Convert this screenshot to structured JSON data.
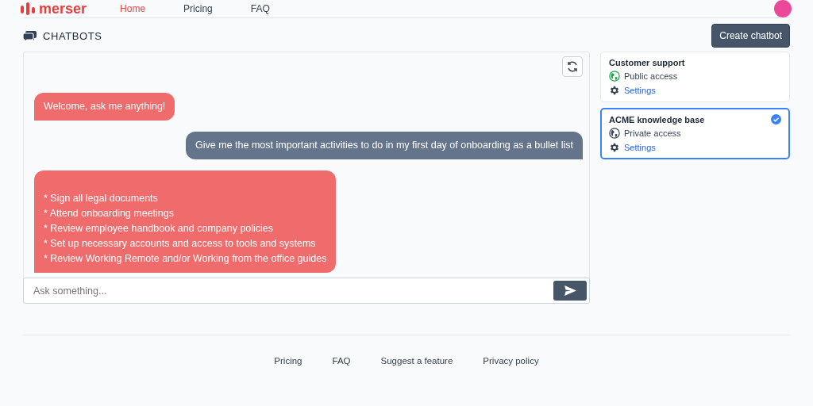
{
  "header": {
    "logo": "merser",
    "nav": [
      {
        "label": "Home",
        "selected": true
      },
      {
        "label": "Pricing",
        "selected": false
      },
      {
        "label": "FAQ",
        "selected": false
      }
    ]
  },
  "page": {
    "title": "CHATBOTS",
    "create_button": "Create chatbot"
  },
  "chat": {
    "messages": [
      {
        "kind": "bot",
        "text": "Welcome, ask me anything!"
      },
      {
        "kind": "user",
        "text": "Give me the most important activities to do in my first day of onboarding as a bullet list"
      },
      {
        "kind": "bot",
        "text": "* Sign all legal documents\n* Attend onboarding meetings\n* Review employee handbook and company policies\n* Set up necessary accounts and access to tools and systems\n* Review Working Remote and/or Working from the office guides"
      }
    ],
    "input": {
      "placeholder": "Ask something..."
    }
  },
  "chatbots": [
    {
      "name": "Customer support",
      "access": "Public access",
      "public": true,
      "settings": "Settings",
      "selected": false
    },
    {
      "name": "ACME knowledge base",
      "access": "Private access",
      "public": false,
      "settings": "Settings",
      "selected": true
    }
  ],
  "footer": {
    "links": [
      "Pricing",
      "FAQ",
      "Suggest a feature",
      "Privacy policy"
    ]
  }
}
